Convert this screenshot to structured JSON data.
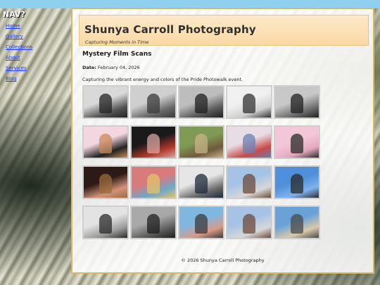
{
  "nav": {
    "heading": "NAV?",
    "links": [
      "Home",
      "Gallery",
      "Collections",
      "About",
      "Services",
      "Blog"
    ]
  },
  "site": {
    "title": "Shunya Carroll Photography",
    "tagline": "Capturing Moments in Time"
  },
  "post": {
    "title": "Mystery Film Scans",
    "date_label": "Date:",
    "date": "February 04, 2026",
    "description": "Capturing the vibrant energy and colors of the Pride Photowalk event."
  },
  "gallery": {
    "thumbnails": [
      {
        "name": "man-in-cap-portrait",
        "colors": [
          "#d9d9d9",
          "#555",
          "#222"
        ]
      },
      {
        "name": "seated-man-outdoors",
        "colors": [
          "#cfcfcf",
          "#6a6a6a",
          "#3a3a3a"
        ]
      },
      {
        "name": "man-closeup-bw",
        "colors": [
          "#bdbdbd",
          "#5a5a5a",
          "#1f1f1f"
        ]
      },
      {
        "name": "bare-tree-bw",
        "colors": [
          "#f0f0f0",
          "#cfcfcf",
          "#333"
        ]
      },
      {
        "name": "man-at-table-bw",
        "colors": [
          "#c8c8c8",
          "#6e6e6e",
          "#202020"
        ]
      },
      {
        "name": "cow-mask-box",
        "colors": [
          "#f3d7e0",
          "#222",
          "#c98a5a"
        ]
      },
      {
        "name": "person-at-car",
        "colors": [
          "#1a1a1a",
          "#b23a2a",
          "#d9a6a0"
        ]
      },
      {
        "name": "deck-green-trees",
        "colors": [
          "#7f9a55",
          "#6f5a3a",
          "#c9b28a"
        ]
      },
      {
        "name": "ferris-wheel-pier",
        "colors": [
          "#e8dde5",
          "#c94a4a",
          "#6b7db2"
        ]
      },
      {
        "name": "pink-sky-figure",
        "colors": [
          "#f4c7d8",
          "#e6a9bf",
          "#2a2a2a"
        ]
      },
      {
        "name": "women-night-selfie",
        "colors": [
          "#2d1a14",
          "#d4927a",
          "#9b6b3c"
        ]
      },
      {
        "name": "confetti-colors",
        "colors": [
          "#d97b7b",
          "#6fa7c9",
          "#e3c46b"
        ]
      },
      {
        "name": "steel-structure-bw",
        "colors": [
          "#e6e6e6",
          "#6b6b6b",
          "#1f2a3a"
        ]
      },
      {
        "name": "person-with-hat-sky",
        "colors": [
          "#a6c3e6",
          "#d8d8d8",
          "#6b4b3b"
        ]
      },
      {
        "name": "pole-blue-sky",
        "colors": [
          "#4f8fd9",
          "#7fb2ef",
          "#2a2a2a"
        ]
      },
      {
        "name": "hat-and-feet-bw",
        "colors": [
          "#e3e3e3",
          "#9a9a9a",
          "#2a2a2a"
        ]
      },
      {
        "name": "people-on-bench-bw",
        "colors": [
          "#a8a8a8",
          "#5a5a5a",
          "#1f1f1f"
        ]
      },
      {
        "name": "face-with-water",
        "colors": [
          "#7fb7e0",
          "#d99a86",
          "#3a3a3a"
        ]
      },
      {
        "name": "person-with-hat-sky-2",
        "colors": [
          "#a6c3e6",
          "#d8d8d8",
          "#6b4b3b"
        ]
      },
      {
        "name": "building-construction",
        "colors": [
          "#6aa2d8",
          "#d9c9a8",
          "#4a4a4a"
        ]
      }
    ]
  },
  "footer": {
    "text": "© 2026 Shunya Carroll Photography"
  }
}
